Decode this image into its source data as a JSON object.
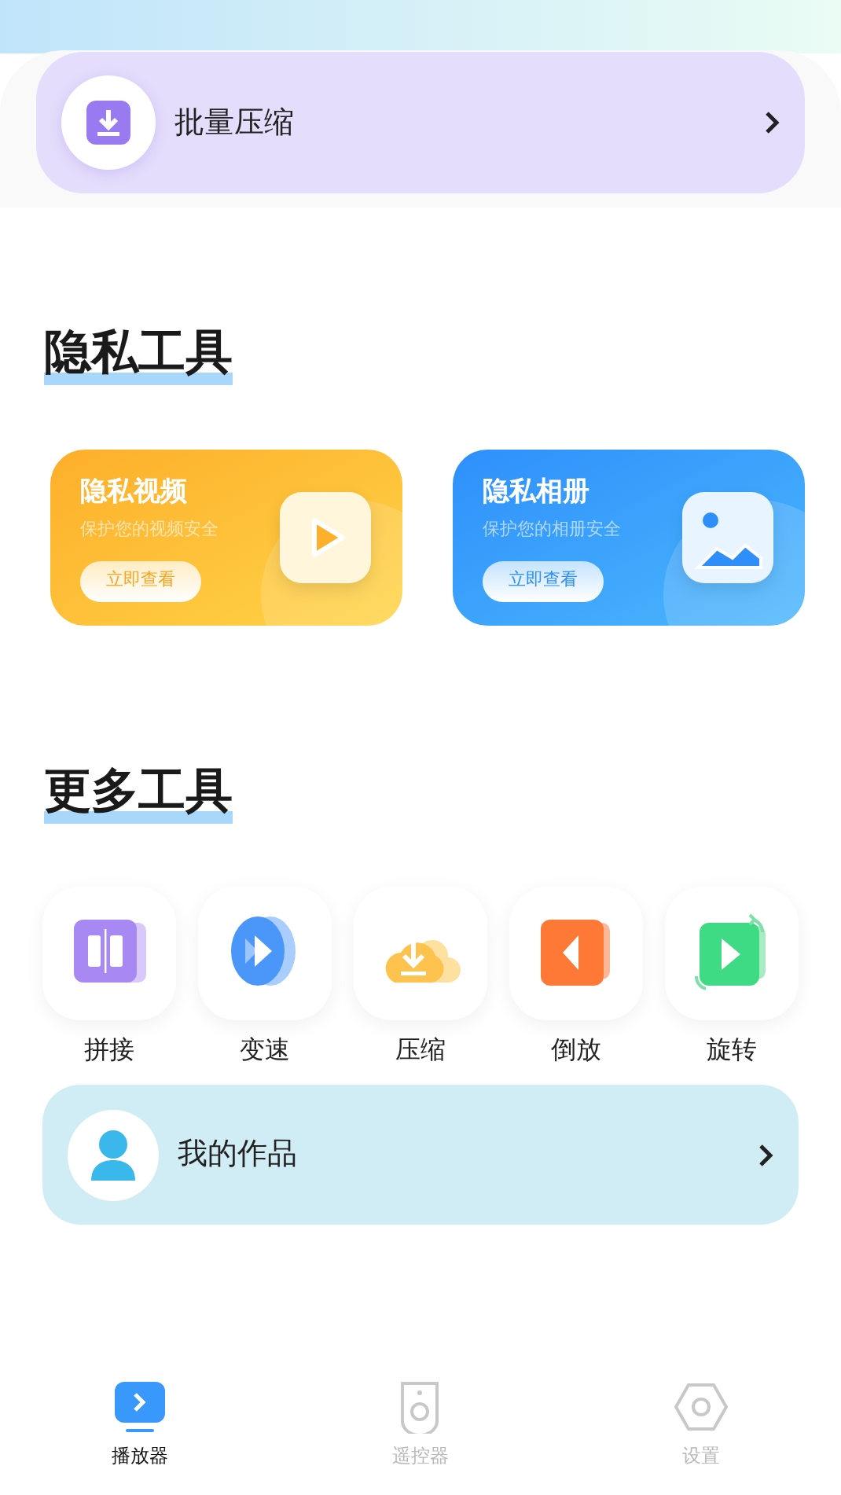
{
  "batch_card": {
    "label": "批量压缩"
  },
  "privacy_section": {
    "title": "隐私工具",
    "cards": [
      {
        "kind": "video",
        "title": "隐私视频",
        "subtitle": "保护您的视频安全",
        "button": "立即查看"
      },
      {
        "kind": "album",
        "title": "隐私相册",
        "subtitle": "保护您的相册安全",
        "button": "立即查看"
      }
    ]
  },
  "more_section": {
    "title": "更多工具",
    "tools": [
      {
        "kind": "splice",
        "label": "拼接"
      },
      {
        "kind": "speed",
        "label": "变速"
      },
      {
        "kind": "compress",
        "label": "压缩"
      },
      {
        "kind": "reverse",
        "label": "倒放"
      },
      {
        "kind": "rotate",
        "label": "旋转"
      }
    ]
  },
  "works_card": {
    "label": "我的作品"
  },
  "tab_bar": [
    {
      "kind": "player",
      "label": "播放器",
      "selected": true
    },
    {
      "kind": "remote",
      "label": "遥控器",
      "selected": false
    },
    {
      "kind": "settings",
      "label": "设置",
      "selected": false
    }
  ]
}
